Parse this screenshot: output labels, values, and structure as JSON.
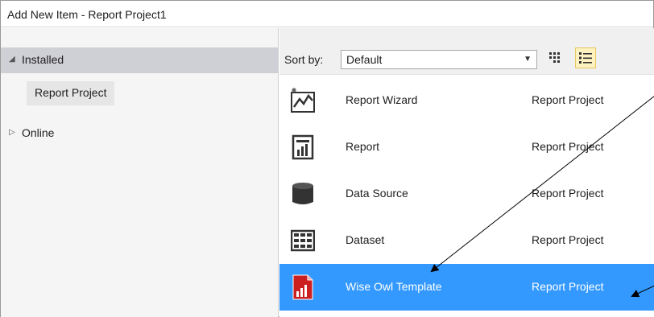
{
  "window": {
    "title": "Add New Item - Report Project1"
  },
  "tree": {
    "installed": "Installed",
    "installed_child": "Report Project",
    "online": "Online"
  },
  "toolbar": {
    "sort_label": "Sort by:",
    "sort_value": "Default"
  },
  "items": [
    {
      "name": "Report Wizard",
      "type": "Report Project",
      "icon": "report-wizard-icon",
      "selected": false
    },
    {
      "name": "Report",
      "type": "Report Project",
      "icon": "report-icon",
      "selected": false
    },
    {
      "name": "Data Source",
      "type": "Report Project",
      "icon": "data-source-icon",
      "selected": false
    },
    {
      "name": "Dataset",
      "type": "Report Project",
      "icon": "dataset-icon",
      "selected": false
    },
    {
      "name": "Wise Owl Template",
      "type": "Report Project",
      "icon": "wise-owl-template-icon",
      "selected": true
    }
  ],
  "colors": {
    "selection": "#3399ff",
    "installed_highlight": "#cfcfd6",
    "template_red": "#cc2020"
  }
}
